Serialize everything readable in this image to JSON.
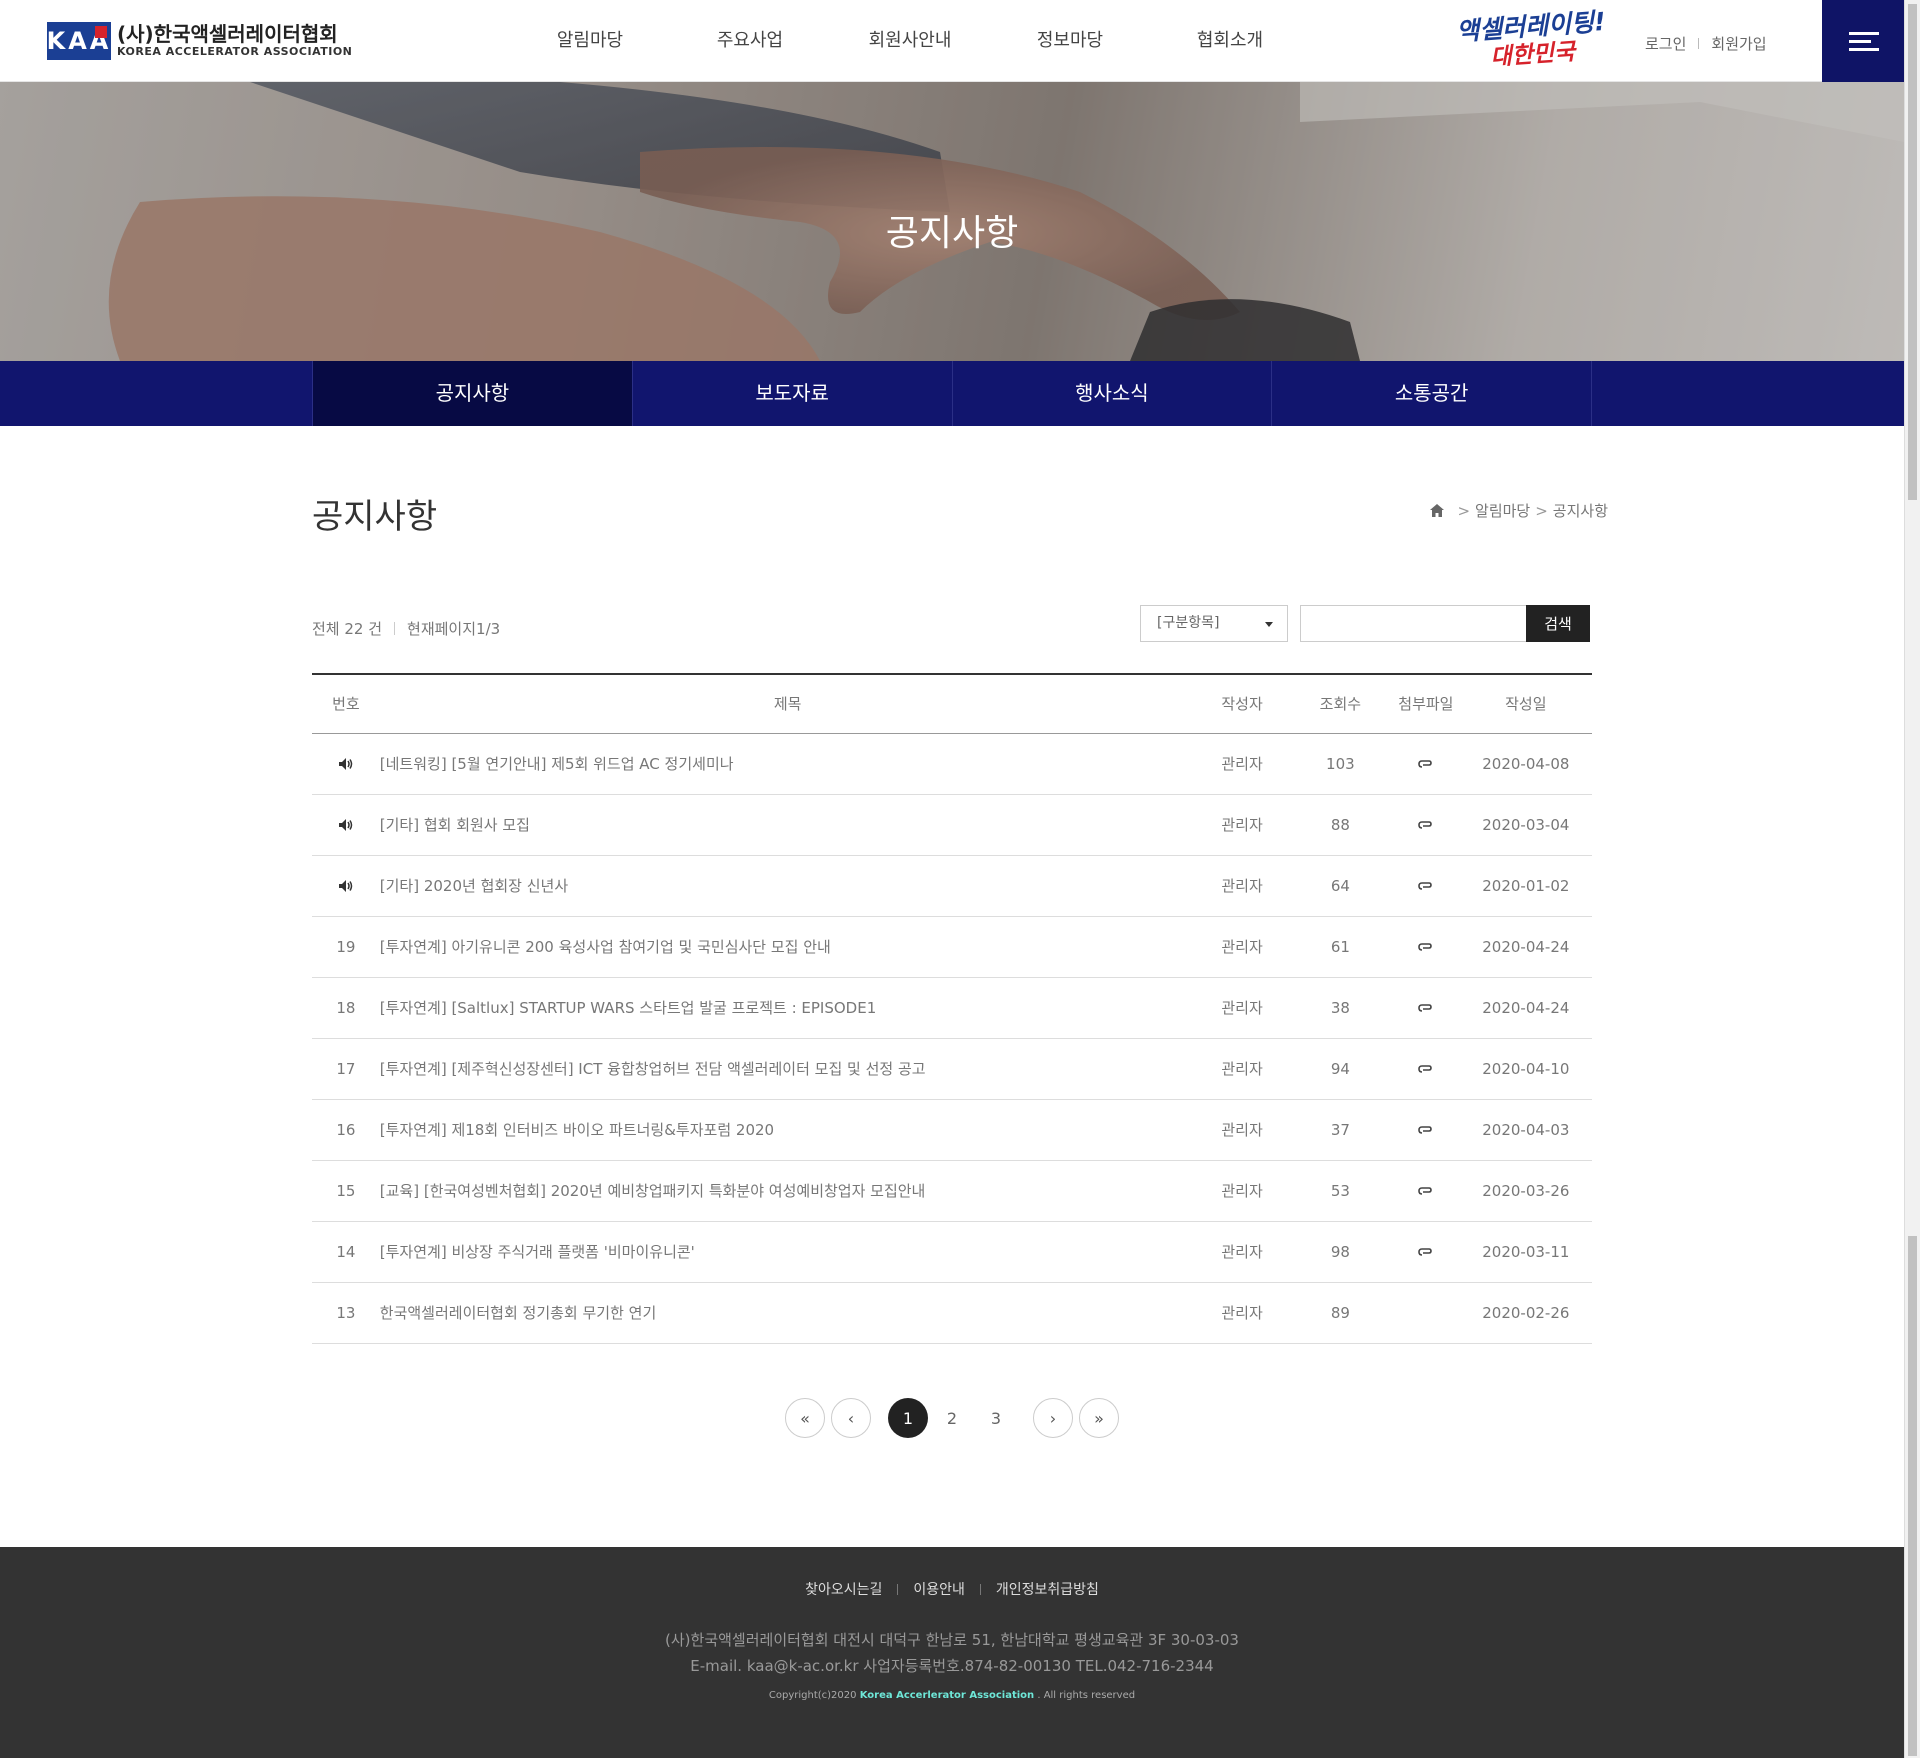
{
  "header": {
    "logo_mark": "KAA",
    "logo_ko": "(사)한국액셀러레이터협회",
    "logo_en": "KOREA ACCELERATOR ASSOCIATION",
    "nav": [
      "알림마당",
      "주요사업",
      "회원사안내",
      "정보마당",
      "협회소개"
    ],
    "slogan_line1": "액셀러레이팅!",
    "slogan_line2": "대한민국",
    "login": "로그인",
    "join": "회원가입"
  },
  "hero": {
    "title": "공지사항"
  },
  "subnav": [
    "공지사항",
    "보도자료",
    "행사소식",
    "소통공간"
  ],
  "page": {
    "title": "공지사항",
    "breadcrumb": [
      "알림마당",
      "공지사항"
    ]
  },
  "board_info": {
    "total": "전체 22 건",
    "current_page": "현재페이지1/3"
  },
  "search": {
    "select_label": "[구분항목]",
    "input_value": "",
    "button": "검색"
  },
  "table": {
    "headers": [
      "번호",
      "제목",
      "작성자",
      "조회수",
      "첨부파일",
      "작성일"
    ],
    "rows": [
      {
        "num": "",
        "notice": true,
        "subject": "[네트워킹] [5월 연기안내] 제5회 위드업 AC 정기세미나",
        "writer": "관리자",
        "hits": "103",
        "file": true,
        "date": "2020-04-08"
      },
      {
        "num": "",
        "notice": true,
        "subject": "[기타] 협회 회원사 모집",
        "writer": "관리자",
        "hits": "88",
        "file": true,
        "date": "2020-03-04"
      },
      {
        "num": "",
        "notice": true,
        "subject": "[기타] 2020년 협회장 신년사",
        "writer": "관리자",
        "hits": "64",
        "file": true,
        "date": "2020-01-02"
      },
      {
        "num": "19",
        "notice": false,
        "subject": "[투자연계] 아기유니콘 200 육성사업 참여기업 및 국민심사단 모집 안내",
        "writer": "관리자",
        "hits": "61",
        "file": true,
        "date": "2020-04-24"
      },
      {
        "num": "18",
        "notice": false,
        "subject": "[투자연계] [Saltlux] STARTUP WARS 스타트업 발굴 프로젝트 : EPISODE1",
        "writer": "관리자",
        "hits": "38",
        "file": true,
        "date": "2020-04-24"
      },
      {
        "num": "17",
        "notice": false,
        "subject": "[투자연계] [제주혁신성장센터] ICT 융합창업허브 전담 액셀러레이터 모집 및 선정 공고",
        "writer": "관리자",
        "hits": "94",
        "file": true,
        "date": "2020-04-10"
      },
      {
        "num": "16",
        "notice": false,
        "subject": "[투자연계] 제18회 인터비즈 바이오 파트너링&투자포럼 2020",
        "writer": "관리자",
        "hits": "37",
        "file": true,
        "date": "2020-04-03"
      },
      {
        "num": "15",
        "notice": false,
        "subject": "[교육] [한국여성벤처협회] 2020년 예비창업패키지 특화분야 여성예비창업자 모집안내",
        "writer": "관리자",
        "hits": "53",
        "file": true,
        "date": "2020-03-26"
      },
      {
        "num": "14",
        "notice": false,
        "subject": "[투자연계] 비상장 주식거래 플랫폼 '비마이유니콘'",
        "writer": "관리자",
        "hits": "98",
        "file": true,
        "date": "2020-03-11"
      },
      {
        "num": "13",
        "notice": false,
        "subject": "한국액셀러레이터협회 정기총회 무기한 연기",
        "writer": "관리자",
        "hits": "89",
        "file": false,
        "date": "2020-02-26"
      }
    ]
  },
  "pagination": {
    "first": "«",
    "prev": "‹",
    "pages": [
      "1",
      "2",
      "3"
    ],
    "current": "1",
    "next": "›",
    "last": "»"
  },
  "footer": {
    "links": [
      "찾아오시는길",
      "이용안내",
      "개인정보취급방침"
    ],
    "address": "(사)한국액셀러레이터협회 대전시 대덕구 한남로 51, 한남대학교 평생교육관 3F 30-03-03",
    "contact": "E-mail. kaa@k-ac.or.kr 사업자등록번호.874-82-00130 TEL.042-716-2344",
    "copy_prefix": "Copyright(c)2020 ",
    "copy_brand": "Korea  Accerlerator Association",
    "copy_suffix": " . All rights reserved"
  },
  "colors": {
    "navy": "#11156e",
    "navy_dark": "#070a44",
    "brand_blue": "#1b3f94",
    "brand_red": "#d6222b",
    "footer_bg": "#333333"
  }
}
